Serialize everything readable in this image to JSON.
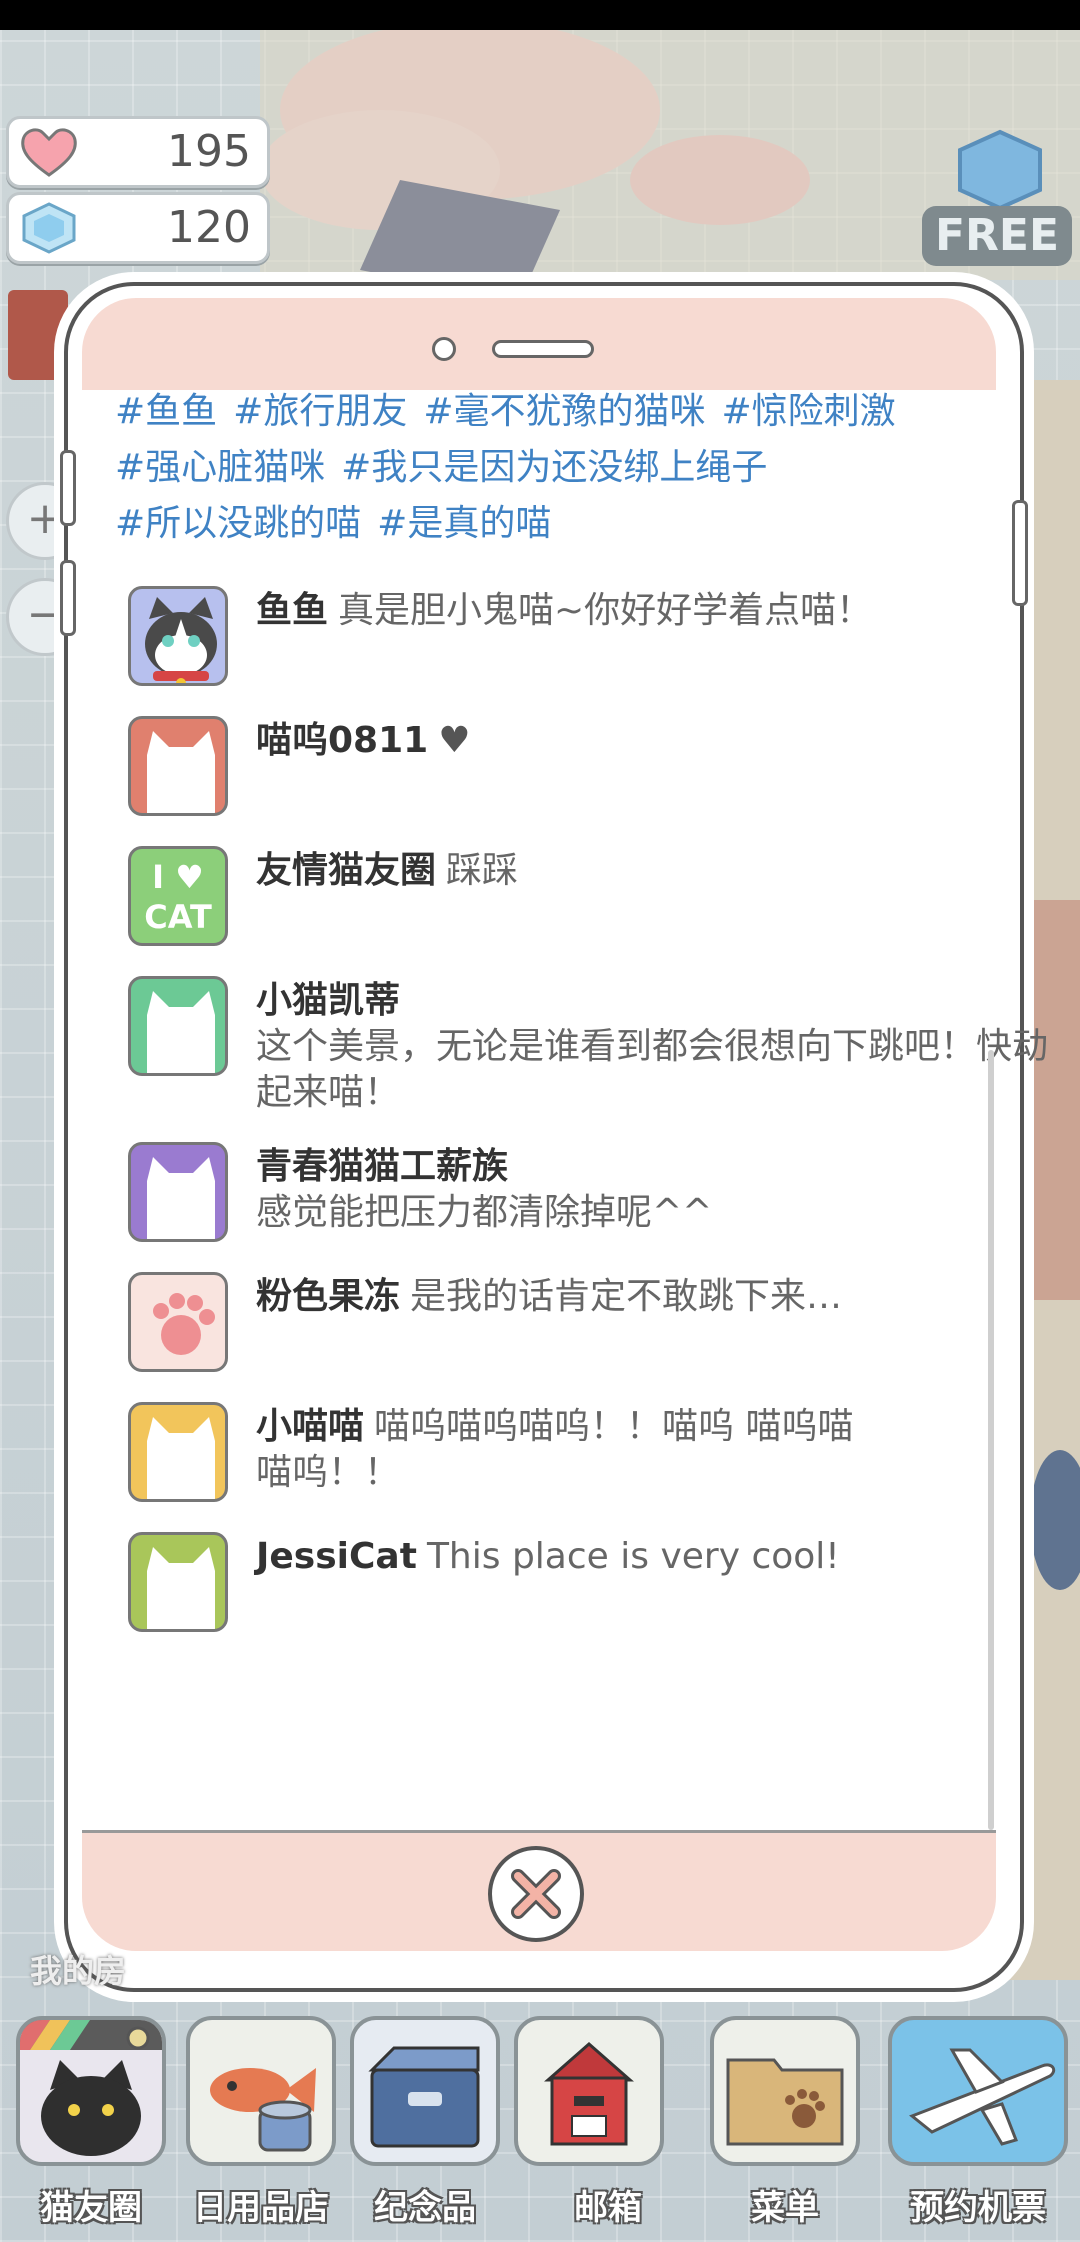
{
  "hud": {
    "hearts": "195",
    "gems": "120",
    "free_label": "FREE",
    "zoom_in": "+",
    "zoom_out": "−"
  },
  "hashtags": [
    [
      "#鱼鱼",
      "#旅行朋友",
      "#毫不犹豫的猫咪",
      "#惊险刺激"
    ],
    [
      "#强心脏猫咪",
      "#我只是因为还没绑上绳子"
    ],
    [
      "#所以没跳的喵",
      "#是真的喵"
    ]
  ],
  "comments": [
    {
      "user": "鱼鱼",
      "text": "真是胆小鬼喵~你好好学着点喵！",
      "avatar": "tuxedo-cat",
      "color": "#9aa7e0"
    },
    {
      "user": "喵呜0811",
      "text": "♥",
      "avatar": "cat-silhouette",
      "color": "#e0806e"
    },
    {
      "user": "友情猫友圈",
      "text": "踩踩",
      "avatar": "i-love-cat",
      "color": "#8ccf7a"
    },
    {
      "user": "小猫凯蒂",
      "text": "这个美景，无论是谁看到都会很想向下跳吧！快动起来喵！",
      "avatar": "cat-silhouette",
      "color": "#6cc995"
    },
    {
      "user": "青春猫猫工薪族",
      "text": "感觉能把压力都清除掉呢^^",
      "avatar": "cat-silhouette",
      "color": "#9a7bd0"
    },
    {
      "user": "粉色果冻",
      "text": "是我的话肯定不敢跳下来…",
      "avatar": "paw",
      "color": "#f5d6d0"
    },
    {
      "user": "小喵喵",
      "text": "喵呜喵呜喵呜！！喵呜 喵呜喵喵呜！！",
      "avatar": "cat-silhouette",
      "color": "#f2c55b"
    },
    {
      "user": "JessiCat",
      "text": "This place is very cool!",
      "avatar": "cat-silhouette",
      "color": "#a9c65a"
    }
  ],
  "avatar_text": {
    "line1": "I ♥",
    "line2": "CAT"
  },
  "mine_label": "我的房",
  "dock": [
    {
      "label": "猫友圈",
      "icon": "cat-camera-icon"
    },
    {
      "label": "日用品店",
      "icon": "shop-icon"
    },
    {
      "label": "纪念品",
      "icon": "souvenir-box-icon"
    },
    {
      "label": "邮箱",
      "icon": "mailbox-icon"
    },
    {
      "label": "菜单",
      "icon": "folder-icon"
    },
    {
      "label": "预约机票",
      "icon": "airplane-icon"
    }
  ]
}
